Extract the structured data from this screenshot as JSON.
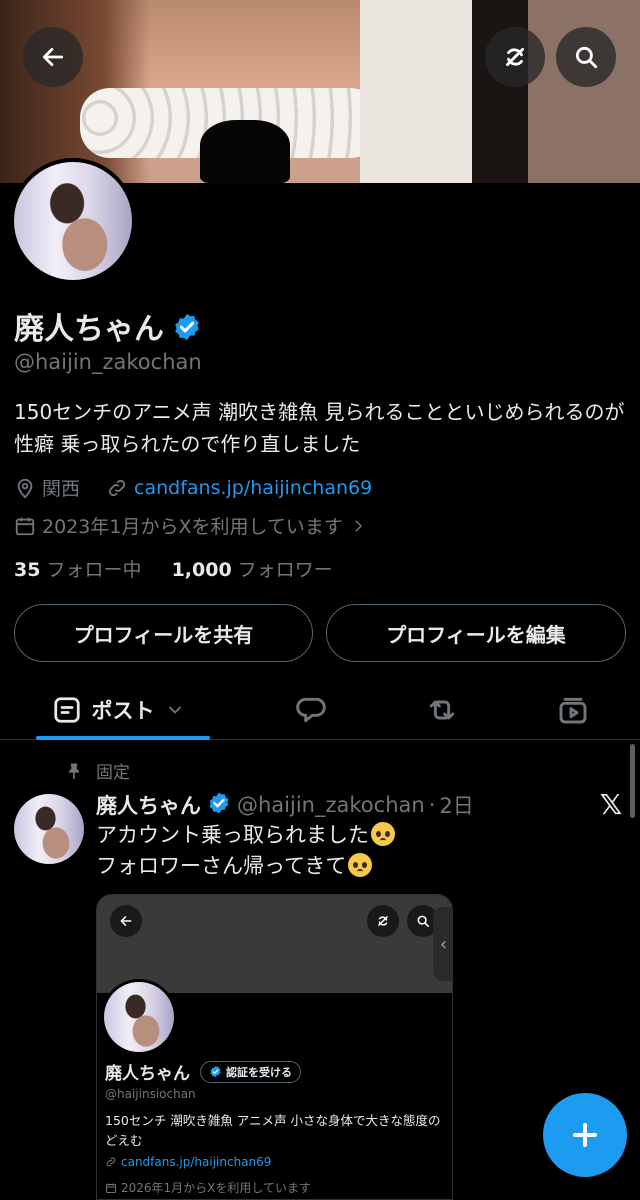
{
  "profile": {
    "name": "廃人ちゃん",
    "handle": "@haijin_zakochan",
    "bio": "150センチのアニメ声 潮吹き雑魚 見られることといじめられるのが性癖 乗っ取られたので作り直しました",
    "location": "関西",
    "website": "candfans.jp/haijinchan69",
    "joined": "2023年1月からXを利用しています",
    "following_count": "35",
    "following_label": "フォロー中",
    "followers_count": "1,000",
    "followers_label": "フォロワー",
    "verified_color": "#1d9bf0"
  },
  "buttons": {
    "share": "プロフィールを共有",
    "edit": "プロフィールを編集"
  },
  "tabs": {
    "posts_label": "ポスト"
  },
  "pinned_post": {
    "pinned_label": "固定",
    "name": "廃人ちゃん",
    "handle": "@haijin_zakochan",
    "dot": "·",
    "time": "2日",
    "line1": "アカウント乗っ取られました",
    "line2": "フォロワーさん帰ってきて"
  },
  "screenshot": {
    "name": "廃人ちゃん",
    "verify_label": "認証を受ける",
    "handle": "@haijinsiochan",
    "bio": "150センチ 潮吹き雑魚 アニメ声 小さな身体で大きな態度のどえむ",
    "website": "candfans.jp/haijinchan69",
    "joined": "2026年1月からXを利用しています"
  },
  "colors": {
    "accent": "#1d9bf0",
    "background": "#000000",
    "secondary_text": "#71767b",
    "border": "#2f3336"
  }
}
